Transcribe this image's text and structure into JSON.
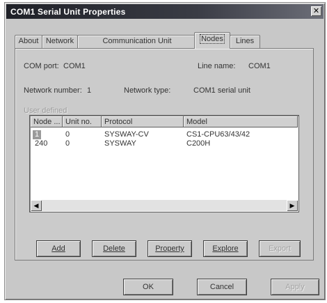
{
  "window": {
    "title": "COM1 Serial Unit Properties",
    "close_glyph": "✕"
  },
  "tabs": [
    {
      "label": "About",
      "active": false
    },
    {
      "label": "Network",
      "active": false
    },
    {
      "label": "Communication Unit",
      "active": false
    },
    {
      "label": "Nodes",
      "active": true
    },
    {
      "label": "Lines",
      "active": false
    }
  ],
  "info": {
    "com_port_label": "COM port:",
    "com_port_value": "COM1",
    "line_name_label": "Line name:",
    "line_name_value": "COM1",
    "network_number_label": "Network number:",
    "network_number_value": "1",
    "network_type_label": "Network type:",
    "network_type_value": "COM1 serial unit",
    "user_defined_label": "User defined"
  },
  "nodes_table": {
    "columns": [
      "Node ...",
      "Unit no.",
      "Protocol",
      "Model"
    ],
    "rows": [
      {
        "node": "1",
        "unit": "0",
        "protocol": "SYSWAY-CV",
        "model": "CS1-CPU63/43/42",
        "selected": true
      },
      {
        "node": "240",
        "unit": "0",
        "protocol": "SYSWAY",
        "model": "C200H",
        "selected": false
      }
    ]
  },
  "icons": {
    "scroll_left": "◀",
    "scroll_right": "▶"
  },
  "node_buttons": {
    "add": "Add",
    "delete": "Delete",
    "property": "Property",
    "explore": "Explore",
    "export": "Export"
  },
  "dialog_buttons": {
    "ok": "OK",
    "cancel": "Cancel",
    "apply": "Apply"
  }
}
